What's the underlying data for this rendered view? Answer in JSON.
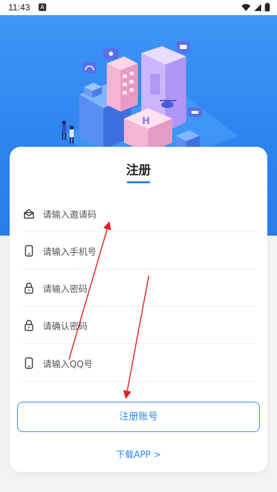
{
  "status_bar": {
    "time": "11:43",
    "notification_letter": "A"
  },
  "page": {
    "title": "注册",
    "fields": [
      {
        "icon": "invite-mail-icon",
        "placeholder": "请输入邀请码"
      },
      {
        "icon": "phone-icon",
        "placeholder": "请输入手机号"
      },
      {
        "icon": "lock-icon",
        "placeholder": "请输入密码"
      },
      {
        "icon": "lock-icon",
        "placeholder": "请确认密码"
      },
      {
        "icon": "phone-icon",
        "placeholder": "请输入QQ号"
      }
    ],
    "register_button": "注册账号",
    "download_link": "下载APP >"
  },
  "colors": {
    "accent": "#2f87f0",
    "hero_top": "#3e96f5",
    "annotation_red": "#e02020"
  }
}
